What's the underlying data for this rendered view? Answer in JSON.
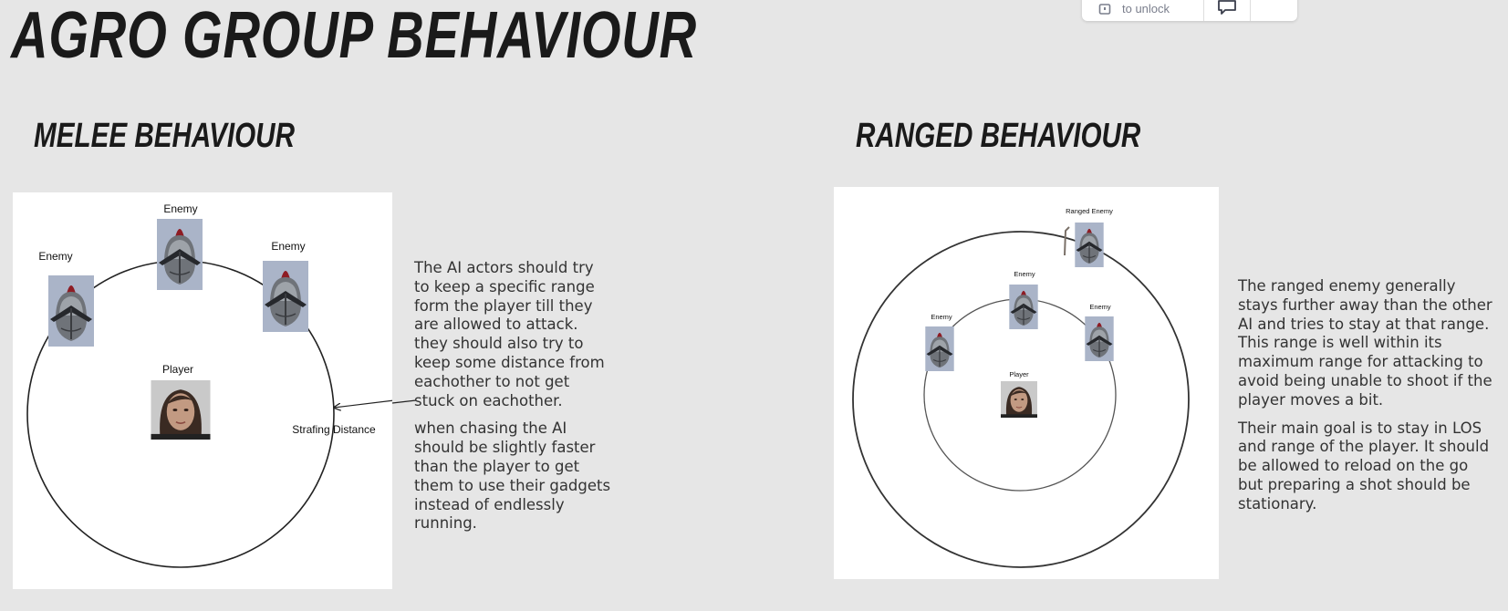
{
  "page": {
    "title": "AGRO GROUP BEHAVIOUR"
  },
  "toolbar": {
    "unlock_label": "to unlock",
    "lock_icon": "lock-icon",
    "comment_icon": "comment-icon"
  },
  "melee": {
    "heading": "MELEE BEHAVIOUR",
    "diagram": {
      "enemy_labels": [
        "Enemy",
        "Enemy",
        "Enemy"
      ],
      "player_label": "Player",
      "strafing_label": "Strafing Distance"
    },
    "paragraphs": [
      "The AI actors should try to keep a specific range form the player till they are allowed to attack. they should also try to keep some distance from eachother to not get stuck on eachother.",
      "when chasing the AI should be slightly faster than the player to get them to use their gadgets instead of endlessly running."
    ]
  },
  "ranged": {
    "heading": "RANGED BEHAVIOUR",
    "diagram": {
      "ranged_enemy_label": "Ranged Enemy",
      "enemy_labels": [
        "Enemy",
        "Enemy",
        "Enemy"
      ],
      "player_label": "Player"
    },
    "paragraphs": [
      "The ranged enemy generally stays further away than the other AI and tries to stay at that range. This range is well within its maximum range for attacking to avoid being unable to shoot if the player moves a bit.",
      "Their main goal is to stay in LOS and range of the player. It should be allowed to reload on the go but preparing a shot should be stationary."
    ]
  }
}
